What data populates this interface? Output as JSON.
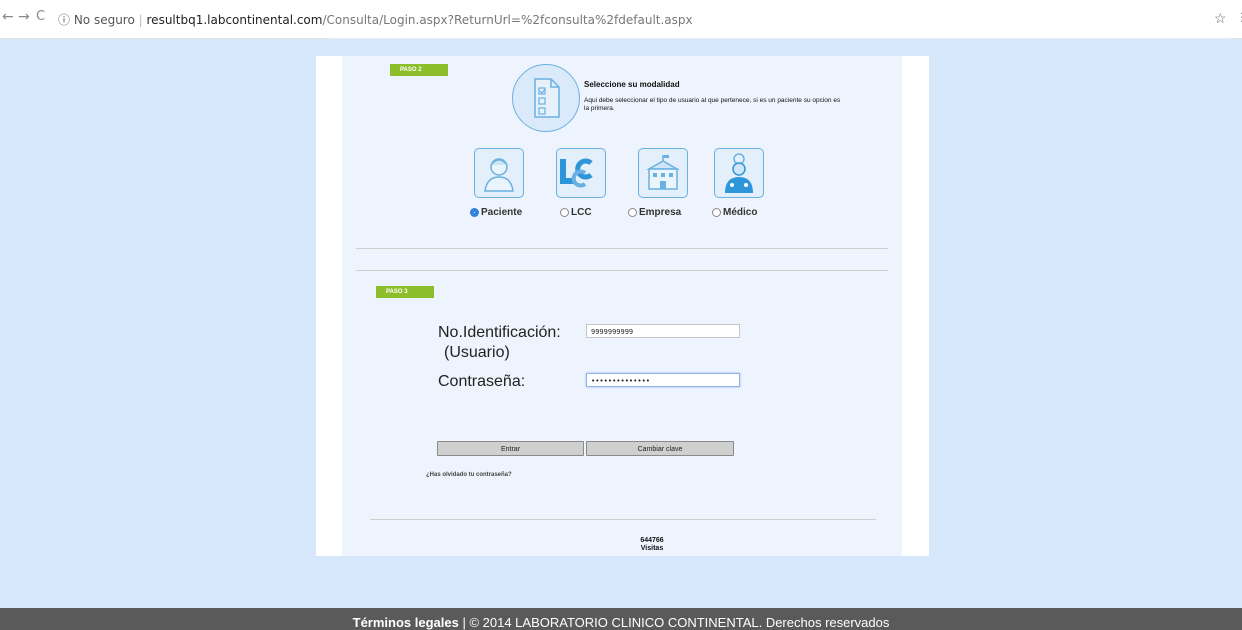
{
  "browser": {
    "back": "←",
    "forward": "→",
    "reload": "C",
    "security": "ⓘ No seguro",
    "host": "resultbq1.labcontinental.com",
    "path": "/Consulta/Login.aspx?ReturnUrl=%2fconsulta%2fdefault.aspx",
    "star": "☆",
    "menu": "⋮"
  },
  "step2": {
    "badge": "PASO 2",
    "title": "Seleccione su modalidad",
    "description": "Aqui debe seleccionar el tipo de usuario al que pertenece, si es un paciente su opcion es la primera.",
    "options": [
      {
        "label": "Paciente",
        "icon": "patient-icon",
        "selected": true
      },
      {
        "label": "LCC",
        "icon": "lcc-logo-icon",
        "selected": false
      },
      {
        "label": "Empresa",
        "icon": "building-icon",
        "selected": false
      },
      {
        "label": "Médico",
        "icon": "doctor-icon",
        "selected": false
      }
    ]
  },
  "step3": {
    "badge": "PASO 3",
    "id_label": "No.Identificación:",
    "id_sublabel": "(Usuario)",
    "id_value": "9999999999",
    "password_label": "Contraseña:",
    "password_value": "••••••••••••••",
    "enter_button": "Entrar",
    "change_button": "Cambiar clave",
    "forgot_link": "¿Has olvidado tu contraseña?"
  },
  "visits": {
    "count": "644766",
    "label": "Visitas"
  },
  "footer": {
    "terms": "Términos legales",
    "copyright": " | © 2014 LABORATORIO CLINICO CONTINENTAL. Derechos reservados"
  },
  "colors": {
    "background": "#d6e6fb",
    "badge": "#8cbe2b",
    "icon_border": "#6ab0e0",
    "footer": "#5a5a5a"
  }
}
